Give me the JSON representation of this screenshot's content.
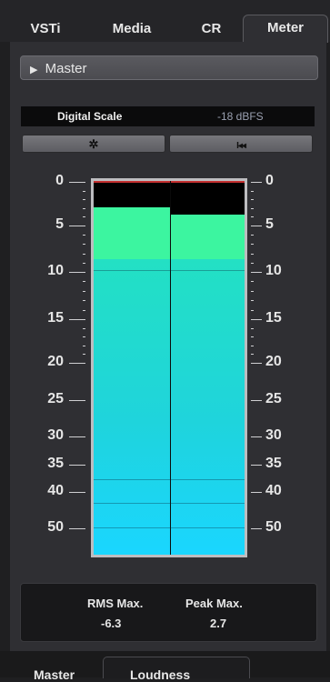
{
  "tabs": [
    "VSTi",
    "Media",
    "CR",
    "Meter"
  ],
  "active_tab": "Meter",
  "section": {
    "title": "Master",
    "expand_glyph": "▶"
  },
  "scale": {
    "label": "Digital Scale",
    "value": "-18 dBFS"
  },
  "buttons": {
    "settings_glyph": "✲",
    "reset_glyph": "I◂◂"
  },
  "meter": {
    "scale_labels": [
      "0",
      "5",
      "10",
      "15",
      "20",
      "25",
      "30",
      "35",
      "40",
      "50"
    ],
    "channels": [
      {
        "name": "left",
        "level_fraction": 0.79,
        "hold_fraction": 0.93
      },
      {
        "name": "right",
        "level_fraction": 0.79,
        "hold_fraction": 0.91
      }
    ],
    "colors": {
      "hold": "#3cf5a0",
      "fill_top": "#23e0c4",
      "fill_bottom": "#1ad6ff",
      "clip_line": "#c43030"
    }
  },
  "stats": {
    "rms_label": "RMS Max.",
    "rms_value": "-6.3",
    "peak_label": "Peak Max.",
    "peak_value": "2.7"
  },
  "bottom_tabs": [
    "Master",
    "Loudness"
  ]
}
